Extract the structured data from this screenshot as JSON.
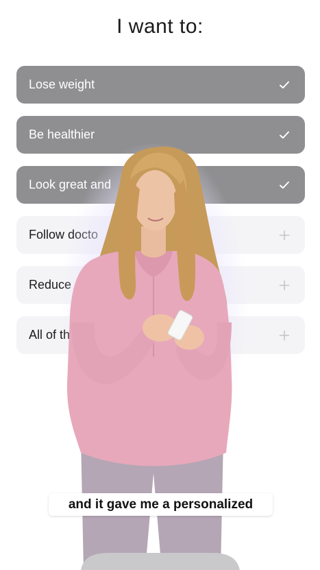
{
  "header": {
    "title": "I want to:"
  },
  "options": [
    {
      "label": "Lose weight",
      "state": "selected",
      "icon": "check-icon"
    },
    {
      "label": "Be healthier",
      "state": "selected",
      "icon": "check-icon"
    },
    {
      "label": "Look great and",
      "state": "selected",
      "icon": "check-icon"
    },
    {
      "label": "Follow docto",
      "state": "unselected",
      "icon": "plus-icon"
    },
    {
      "label": "Reduce",
      "state": "unselected",
      "icon": "plus-icon"
    },
    {
      "label": "All of th",
      "state": "unselected",
      "icon": "plus-icon"
    }
  ],
  "caption": {
    "text": "and it gave me a personalized"
  },
  "colors": {
    "selected_bg": "#8f8f92",
    "unselected_bg": "#f4f4f6",
    "top_color": "#e6a6b9",
    "pants_color": "#b3a4b2",
    "hair_color": "#c49755"
  }
}
